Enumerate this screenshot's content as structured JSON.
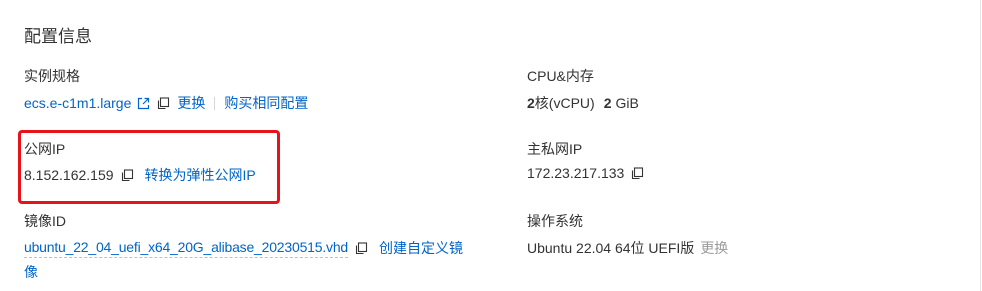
{
  "section": {
    "title": "配置信息"
  },
  "instance_spec": {
    "label": "实例规格",
    "value": "ecs.e-c1m1.large",
    "change_label": "更换",
    "buy_same_label": "购买相同配置"
  },
  "cpu_mem": {
    "label": "CPU&内存",
    "cpu_count": "2",
    "cpu_unit": "核(vCPU)",
    "mem_size": "2",
    "mem_unit": "GiB"
  },
  "public_ip": {
    "label": "公网IP",
    "value": "8.152.162.159",
    "convert_label": "转换为弹性公网IP"
  },
  "private_ip": {
    "label": "主私网IP",
    "value": "172.23.217.133"
  },
  "image_id": {
    "label": "镜像ID",
    "value": "ubuntu_22_04_uefi_x64_20G_alibase_20230515.vhd",
    "create_custom_label_line1": "创建自定义镜",
    "create_custom_label_line2": "像"
  },
  "os": {
    "label": "操作系统",
    "value": "Ubuntu 22.04 64位 UEFI版",
    "change_label": "更换"
  },
  "colors": {
    "link": "#0064c8",
    "highlight": "#e8121b",
    "muted": "#9a9a9a"
  }
}
